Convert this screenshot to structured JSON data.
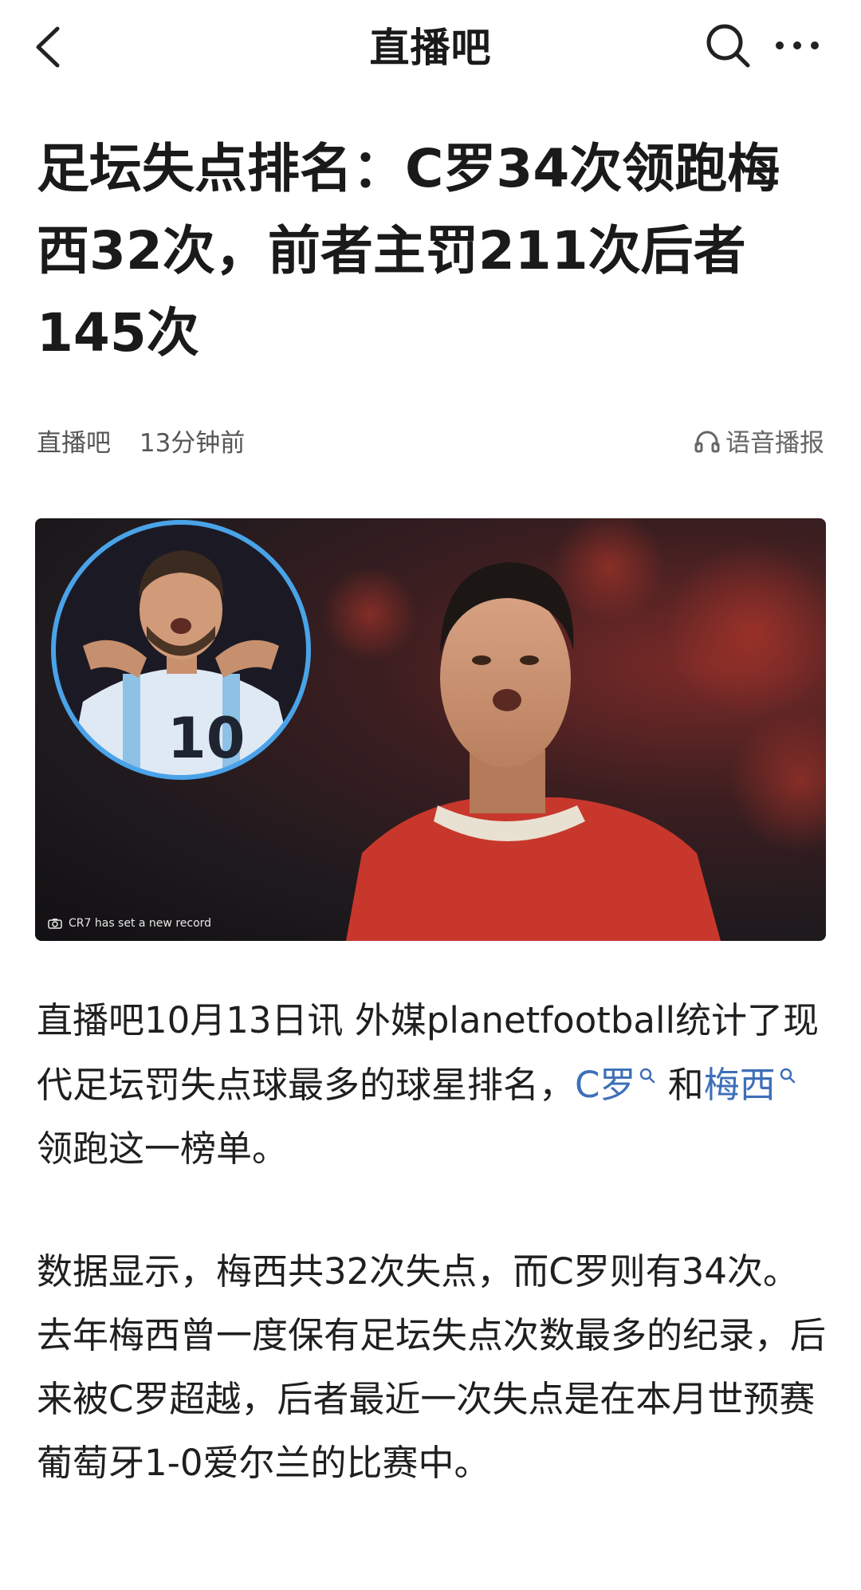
{
  "topbar": {
    "title": "直播吧"
  },
  "article": {
    "headline": "足坛失点排名：C罗34次领跑梅西32次，前者主罚211次后者145次",
    "source": "直播吧",
    "time": "13分钟前",
    "tts_label": "语音播报",
    "image": {
      "caption": "CR7 has set a new record",
      "inset_jersey_number": "10"
    },
    "p1": {
      "text_before": "直播吧10月13日讯 外媒planetfootball统计了现代足坛罚失点球最多的球星排名，",
      "link1": "C罗",
      "text_middle": " 和",
      "link2": "梅西",
      "text_after": " 领跑这一榜单。"
    },
    "p2": "数据显示，梅西共32次失点，而C罗则有34次。去年梅西曾一度保有足坛失点次数最多的纪录，后来被C罗超越，后者最近一次失点是在本月世预赛葡萄牙1-0爱尔兰的比赛中。"
  }
}
